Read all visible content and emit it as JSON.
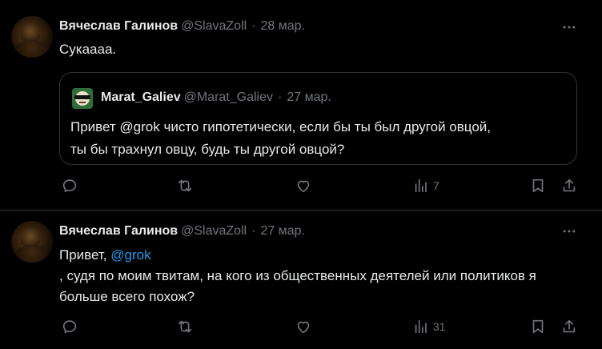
{
  "posts": [
    {
      "author_name": "Вячеслав Галинов",
      "author_handle": "@SlavaZoll",
      "separator": "·",
      "time": "28 мар.",
      "text": "Сукаааа.",
      "quote": {
        "author_name": "Marat_Galiev",
        "author_handle": "@Marat_Galiev",
        "separator": "·",
        "time": "27 мар.",
        "line1": "Привет @grok чисто гипотетически, если бы ты был другой овцой,",
        "line2": "ты бы трахнул овцу, будь ты другой овцой?"
      },
      "views": "7"
    },
    {
      "author_name": "Вячеслав Галинов",
      "author_handle": "@SlavaZoll",
      "separator": "·",
      "time": "27 мар.",
      "text_prefix": "Привет, ",
      "mention": "@grok",
      "line2": ", судя по моим твитам, на кого из общественных деятелей или политиков я",
      "line3": "больше всего похож?",
      "views": "31"
    }
  ],
  "icons": [
    "more-icon",
    "reply-icon",
    "repost-icon",
    "like-icon",
    "views-icon",
    "bookmark-icon",
    "share-icon"
  ],
  "colors": {
    "background": "#000000",
    "text": "#e7e9ea",
    "muted": "#71767b",
    "link": "#1d9bf0",
    "border": "#2f3336"
  }
}
